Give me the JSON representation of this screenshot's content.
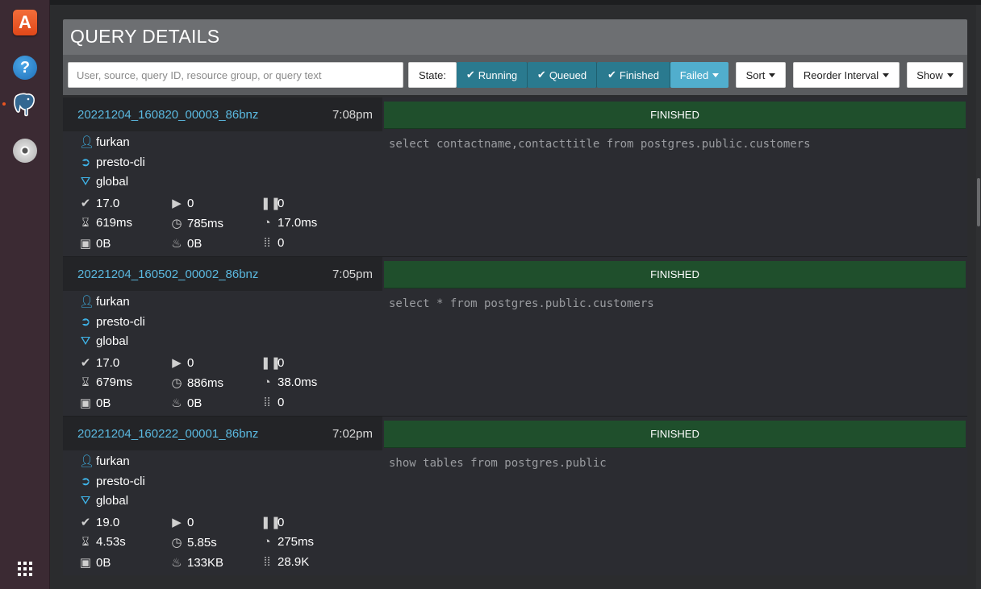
{
  "dock": {
    "apps": [
      {
        "name": "Ubuntu Software",
        "icon": "shopping-bag-icon",
        "glyph": "A"
      },
      {
        "name": "Help",
        "icon": "help-icon",
        "glyph": "?"
      },
      {
        "name": "pgAdmin",
        "icon": "postgres-elephant-icon"
      },
      {
        "name": "Disc",
        "icon": "disc-icon"
      }
    ],
    "show_apps_icon": "apps-grid-icon"
  },
  "header": {
    "title": "QUERY DETAILS"
  },
  "toolbar": {
    "search_placeholder": "User, source, query ID, resource group, or query text",
    "state_label": "State:",
    "states": [
      {
        "label": "Running",
        "checked": true
      },
      {
        "label": "Queued",
        "checked": true
      },
      {
        "label": "Finished",
        "checked": true
      },
      {
        "label": "Failed",
        "checked": false,
        "dropdown": true
      }
    ],
    "sort_label": "Sort",
    "reorder_label": "Reorder Interval",
    "show_label": "Show"
  },
  "colors": {
    "accent_link": "#5bb9e0",
    "state_active": "#2a7a8f",
    "state_failed": "#51aecd",
    "finished_bg": "#1f4f2c"
  },
  "queries": [
    {
      "id": "20221204_160820_00003_86bnz",
      "time": "7:08pm",
      "status": "FINISHED",
      "user": "furkan",
      "source": "presto-cli",
      "resource_group": "global",
      "completed_splits": "17.0",
      "running_splits": "0",
      "queued_splits": "0",
      "wall_time": "619ms",
      "elapsed_time": "785ms",
      "cpu_time": "17.0ms",
      "memory": "0B",
      "peak_memory": "0B",
      "rows": "0",
      "query_text": "select contactname,contacttitle from postgres.public.customers"
    },
    {
      "id": "20221204_160502_00002_86bnz",
      "time": "7:05pm",
      "status": "FINISHED",
      "user": "furkan",
      "source": "presto-cli",
      "resource_group": "global",
      "completed_splits": "17.0",
      "running_splits": "0",
      "queued_splits": "0",
      "wall_time": "679ms",
      "elapsed_time": "886ms",
      "cpu_time": "38.0ms",
      "memory": "0B",
      "peak_memory": "0B",
      "rows": "0",
      "query_text": "select * from postgres.public.customers"
    },
    {
      "id": "20221204_160222_00001_86bnz",
      "time": "7:02pm",
      "status": "FINISHED",
      "user": "furkan",
      "source": "presto-cli",
      "resource_group": "global",
      "completed_splits": "19.0",
      "running_splits": "0",
      "queued_splits": "0",
      "wall_time": "4.53s",
      "elapsed_time": "5.85s",
      "cpu_time": "275ms",
      "memory": "0B",
      "peak_memory": "133KB",
      "rows": "28.9K",
      "query_text": "show tables from postgres.public"
    }
  ]
}
